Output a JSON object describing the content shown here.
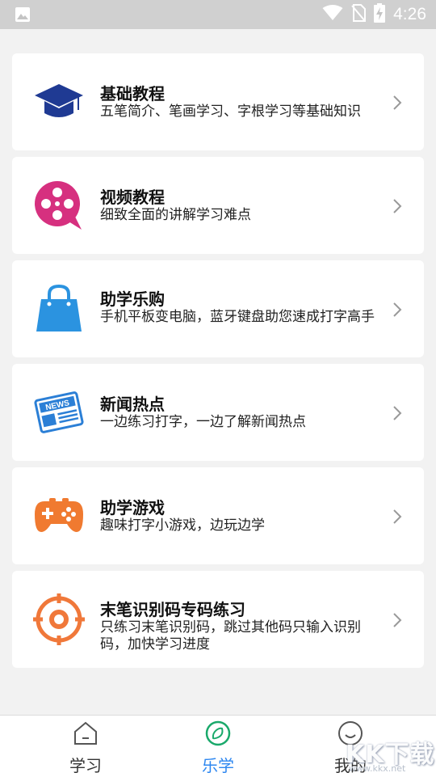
{
  "status_bar": {
    "time": "4:26",
    "icons": [
      "image-icon",
      "wifi-icon",
      "no-sim-icon",
      "battery-charging-icon"
    ]
  },
  "cards": [
    {
      "title": "基础教程",
      "desc": "五笔简介、笔画学习、字根学习等基础知识",
      "icon": "graduation-cap-icon"
    },
    {
      "title": "视频教程",
      "desc": "细致全面的讲解学习难点",
      "icon": "film-reel-icon"
    },
    {
      "title": "助学乐购",
      "desc": "手机平板变电脑，蓝牙键盘助您速成打字高手",
      "icon": "shopping-bag-icon"
    },
    {
      "title": "新闻热点",
      "desc": "一边练习打字，一边了解新闻热点",
      "icon": "newspaper-icon",
      "icon_text": "NEWS"
    },
    {
      "title": "助学游戏",
      "desc": "趣味打字小游戏，边玩边学",
      "icon": "gamepad-icon"
    },
    {
      "title": "末笔识别码专码练习",
      "desc": "只练习末笔识别码，跳过其他码只输入识别码，加快学习进度",
      "icon": "target-icon"
    }
  ],
  "tabs": [
    {
      "label": "学习",
      "icon": "home-icon",
      "active": false
    },
    {
      "label": "乐学",
      "icon": "compass-icon",
      "active": true
    },
    {
      "label": "我的",
      "icon": "profile-icon",
      "active": false
    }
  ],
  "watermark": {
    "text": "KK下载",
    "url": "www.kkx.net"
  },
  "colors": {
    "accent": "#2d87f0",
    "tab_active_icon": "#1aa96b",
    "graduation": "#1f3a93",
    "film": "#d6307f",
    "bag": "#2b93e0",
    "news": "#2b7fd6",
    "game": "#f07a30",
    "target": "#f0783a"
  }
}
